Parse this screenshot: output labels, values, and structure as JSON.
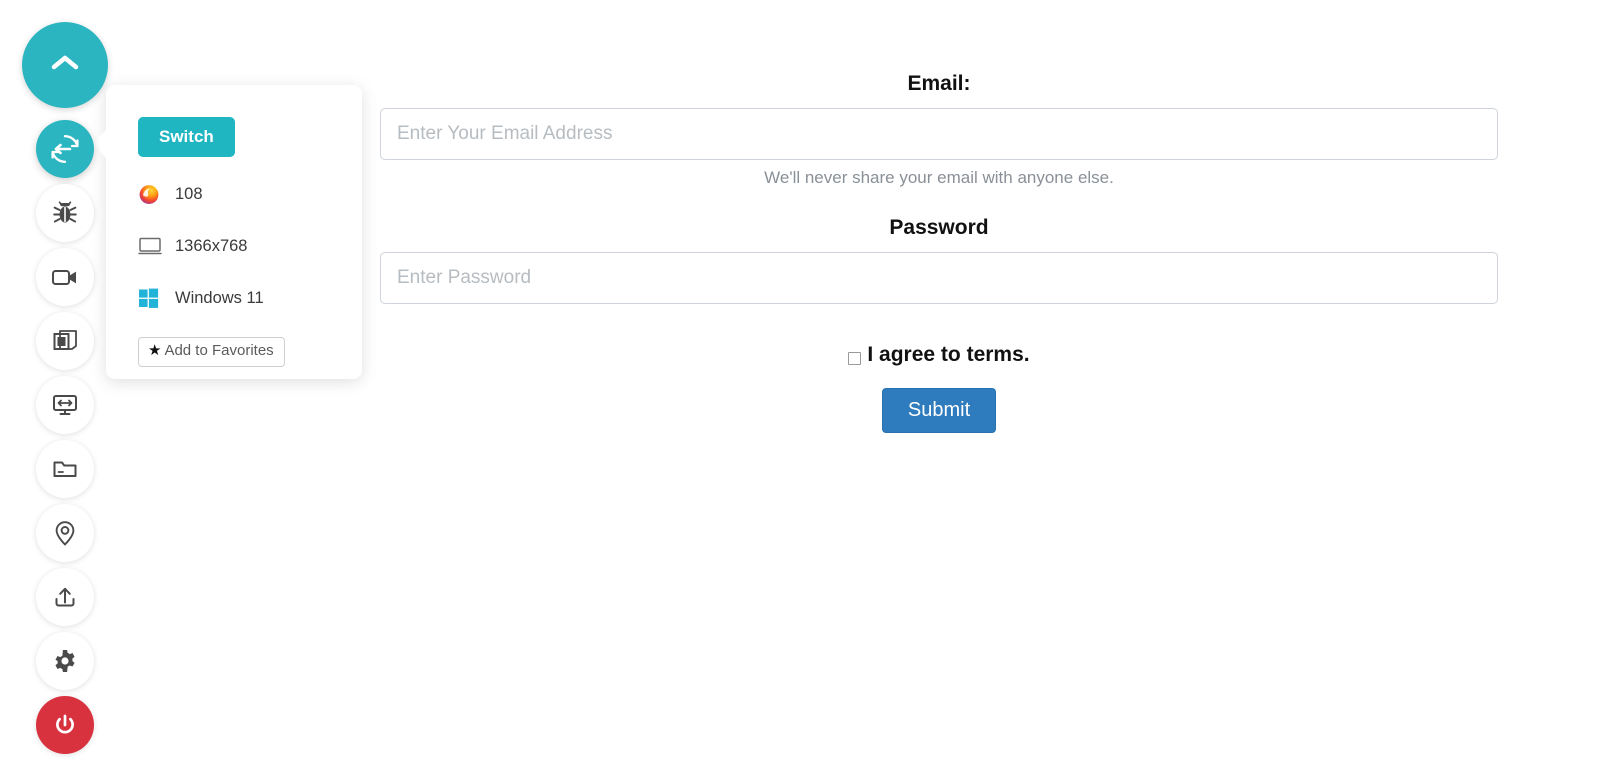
{
  "theme": {
    "accent_teal": "#2bb5c0",
    "switch_teal": "#1fb6c1",
    "power_red": "#d9323f",
    "submit_blue": "#2e7cbe",
    "page_background": "#ffffff",
    "muted_text": "#8a9097"
  },
  "sidebar": {
    "toggle": {
      "name": "collapse-toggle",
      "icon": "chevron-up-icon"
    },
    "items": [
      {
        "id": "switch",
        "icon": "switch-arrows-icon",
        "label": "Switch",
        "active": true
      },
      {
        "id": "bug",
        "icon": "bug-icon",
        "label": "Report Bug",
        "active": false
      },
      {
        "id": "record",
        "icon": "video-camera-icon",
        "label": "Record",
        "active": false
      },
      {
        "id": "screenshot",
        "icon": "copy-layers-icon",
        "label": "Screenshots",
        "active": false
      },
      {
        "id": "resolution",
        "icon": "monitor-resize-icon",
        "label": "Resolution",
        "active": false
      },
      {
        "id": "files",
        "icon": "folder-icon",
        "label": "Files",
        "active": false
      },
      {
        "id": "location",
        "icon": "map-pin-icon",
        "label": "Location",
        "active": false
      },
      {
        "id": "upload",
        "icon": "upload-icon",
        "label": "Upload",
        "active": false
      },
      {
        "id": "settings",
        "icon": "gear-icon",
        "label": "Settings",
        "active": false
      },
      {
        "id": "power",
        "icon": "power-icon",
        "label": "Stop Session",
        "active": false
      }
    ]
  },
  "popup": {
    "switch_button_label": "Switch",
    "rows": [
      {
        "icon": "firefox-icon",
        "value": "108"
      },
      {
        "icon": "monitor-icon",
        "value": "1366x768"
      },
      {
        "icon": "windows-icon",
        "value": "Windows 11"
      }
    ],
    "favorites_button": {
      "star": "★",
      "label": "Add to Favorites"
    }
  },
  "form": {
    "email": {
      "label": "Email:",
      "placeholder": "Enter Your Email Address",
      "value": "",
      "help_text": "We'll never share your email with anyone else."
    },
    "password": {
      "label": "Password",
      "placeholder": "Enter Password",
      "value": ""
    },
    "terms": {
      "label": "I agree to terms.",
      "checked": false
    },
    "submit_label": "Submit"
  }
}
